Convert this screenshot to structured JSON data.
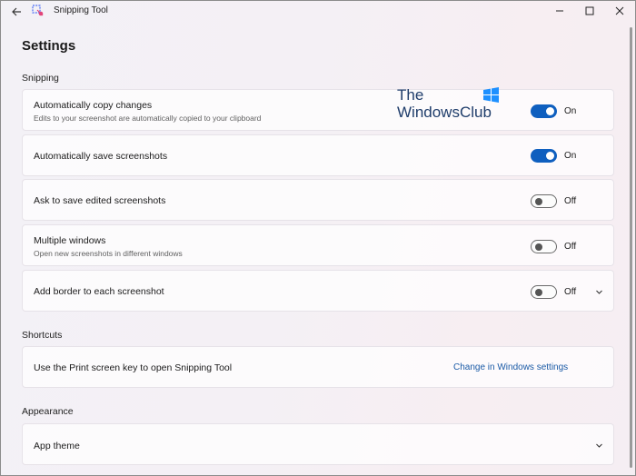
{
  "window": {
    "title": "Snipping Tool",
    "back_icon": "back-arrow-icon",
    "controls": [
      "minimize-icon",
      "maximize-icon",
      "close-icon"
    ]
  },
  "page": {
    "title": "Settings"
  },
  "sections": {
    "snipping": {
      "title": "Snipping",
      "items": [
        {
          "label": "Automatically copy changes",
          "description": "Edits to your screenshot are automatically copied to your clipboard",
          "state": "On"
        },
        {
          "label": "Automatically save screenshots",
          "state": "On"
        },
        {
          "label": "Ask to save edited screenshots",
          "state": "Off"
        },
        {
          "label": "Multiple windows",
          "description": "Open new screenshots in different windows",
          "state": "Off"
        },
        {
          "label": "Add border to each screenshot",
          "state": "Off"
        }
      ]
    },
    "shortcuts": {
      "title": "Shortcuts",
      "item_label": "Use the Print screen key to open Snipping Tool",
      "link": "Change in Windows settings"
    },
    "appearance": {
      "title": "Appearance",
      "item_label": "App theme"
    }
  },
  "watermark": {
    "line1": "The",
    "line2": "WindowsClub"
  },
  "colors": {
    "accent": "#0f5fbf",
    "link": "#1a5aa6",
    "watermark": "#1f3d6b",
    "watermark_logo": "#1e90ff"
  }
}
